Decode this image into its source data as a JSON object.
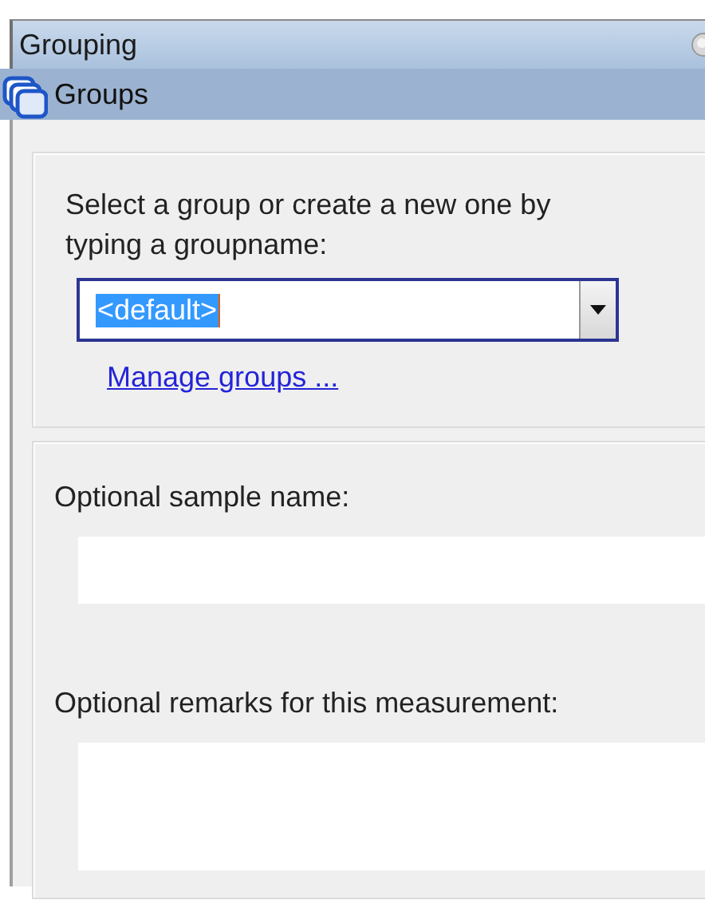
{
  "window": {
    "title": "Grouping"
  },
  "section": {
    "title": "Groups"
  },
  "group_card": {
    "prompt": "Select a group or create a new one by typing a groupname:",
    "combo": {
      "value": "<default>",
      "text_selected": true,
      "focused": true
    },
    "link": "Manage groups ..."
  },
  "sample_card": {
    "fields": [
      {
        "label": "Optional sample name:",
        "kind": "line"
      },
      {
        "label": "Optional remarks for this measurement:",
        "kind": "multiline"
      }
    ]
  }
}
